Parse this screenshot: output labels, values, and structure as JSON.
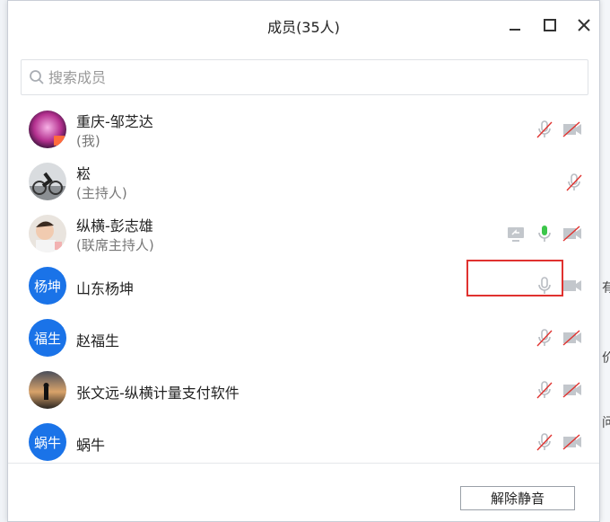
{
  "dialog": {
    "title": "成员(35人)",
    "search_placeholder": "搜索成员",
    "unmute_all_label": "解除静音"
  },
  "members": [
    {
      "name": "重庆-邹芝达",
      "role": "(我)",
      "avatar": "photo-pink",
      "mic": "muted",
      "video": "off"
    },
    {
      "name": "崧",
      "role": "(主持人)",
      "avatar": "photo-bike",
      "mic": "muted",
      "video": null
    },
    {
      "name": "纵横-彭志雄",
      "role": "(联席主持人)",
      "avatar": "photo-child",
      "screen_share": true,
      "mic": "active",
      "video": "off"
    },
    {
      "name": "山东杨坤",
      "role": "",
      "avatar_text": "杨坤",
      "mic": "on",
      "video": "on"
    },
    {
      "name": "赵福生",
      "role": "",
      "avatar_text": "福生",
      "mic": "muted",
      "video": "off"
    },
    {
      "name": "张文远-纵横计量支付软件",
      "role": "",
      "avatar": "photo-sunset",
      "mic": "muted",
      "video": "off"
    },
    {
      "name": "蜗牛",
      "role": "",
      "avatar_text": "蜗牛",
      "mic": "muted",
      "video": "off"
    }
  ],
  "background_fragments": [
    "有",
    "价",
    "问"
  ],
  "colors": {
    "accent_blue": "#1a73e8",
    "mic_active_green": "#3cc64a",
    "muted_red": "#e0322f",
    "icon_gray": "#b8bcc2",
    "highlight_red": "#e0322f"
  }
}
